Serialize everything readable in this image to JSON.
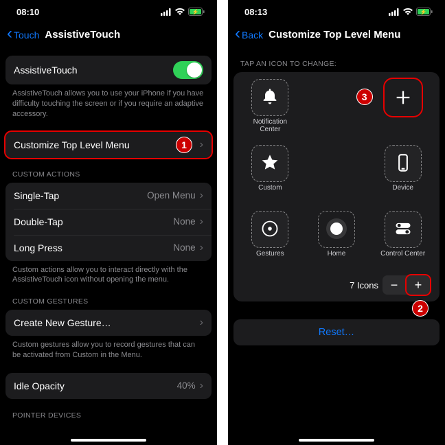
{
  "left": {
    "status": {
      "time": "08:10"
    },
    "nav": {
      "back": "Touch",
      "title": "AssistiveTouch"
    },
    "assistive": {
      "label": "AssistiveTouch",
      "footer": "AssistiveTouch allows you to use your iPhone if you have difficulty touching the screen or if you require an adaptive accessory."
    },
    "customize": {
      "label": "Customize Top Level Menu"
    },
    "custom_actions_header": "CUSTOM ACTIONS",
    "actions": [
      {
        "label": "Single-Tap",
        "value": "Open Menu"
      },
      {
        "label": "Double-Tap",
        "value": "None"
      },
      {
        "label": "Long Press",
        "value": "None"
      }
    ],
    "custom_actions_footer": "Custom actions allow you to interact directly with the AssistiveTouch icon without opening the menu.",
    "custom_gestures_header": "CUSTOM GESTURES",
    "create_gesture": "Create New Gesture…",
    "gestures_footer": "Custom gestures allow you to record gestures that can be activated from Custom in the Menu.",
    "idle": {
      "label": "Idle Opacity",
      "value": "40%"
    },
    "pointer_header": "POINTER DEVICES"
  },
  "right": {
    "status": {
      "time": "08:13"
    },
    "nav": {
      "back": "Back",
      "title": "Customize Top Level Menu"
    },
    "section_header": "TAP AN ICON TO CHANGE:",
    "icons": {
      "notification": "Notification Center",
      "custom": "Custom",
      "device": "Device",
      "gestures": "Gestures",
      "home": "Home",
      "control": "Control Center"
    },
    "icon_count_label": "7 Icons",
    "reset": "Reset…"
  },
  "callouts": {
    "one": "1",
    "two": "2",
    "three": "3"
  }
}
